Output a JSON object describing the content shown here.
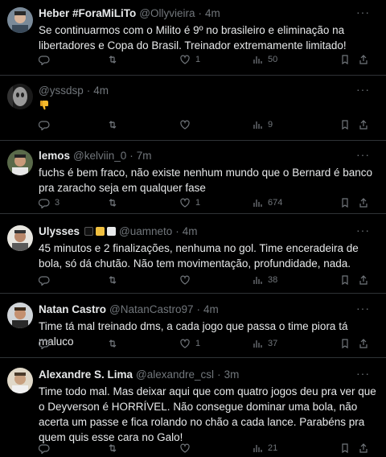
{
  "tweets": [
    {
      "name": "Heber #ForaMiLiTo",
      "handle": "@Ollyvieira",
      "time": "4m",
      "text": "Se continuarmos com o Milito é 9º no brasileiro e eliminação na libertadores e Copa do Brasil. Treinador extremamente limitado!",
      "replies": "",
      "retweets": "",
      "likes": "1",
      "views": "50"
    },
    {
      "name": "",
      "handle": "@yssdsp",
      "time": "4m",
      "text": "",
      "emoji": "thumbs-down",
      "replies": "",
      "retweets": "",
      "likes": "",
      "views": "9"
    },
    {
      "name": "lemos",
      "handle": "@kelviin_0",
      "time": "7m",
      "text": "fuchs é bem fraco, não existe nenhum mundo que o Bernard é banco pra zaracho seja em qualquer fase",
      "replies": "3",
      "retweets": "",
      "likes": "1",
      "views": "674"
    },
    {
      "name": "Ulysses",
      "handle": "@uamneto",
      "time": "4m",
      "text": "45 minutos e 2 finalizações, nenhuma no gol. Time enceradeira de bola, só dá chutão. Não tem movimentação, profundidade, nada.",
      "replies": "",
      "retweets": "",
      "likes": "",
      "views": "38"
    },
    {
      "name": "Natan Castro",
      "handle": "@NatanCastro97",
      "time": "4m",
      "text": "Time tá mal treinado dms, a cada jogo que passa o time piora tá maluco",
      "replies": "",
      "retweets": "",
      "likes": "1",
      "views": "37"
    },
    {
      "name": "Alexandre S. Lima",
      "handle": "@alexandre_csl",
      "time": "3m",
      "text": "Time todo mal. Mas deixar aqui que com quatro jogos deu pra ver que o Deyverson é HORRÍVEL. Não consegue dominar uma bola, não acerta um passe e fica rolando no chão a cada lance. Parabéns pra quem quis esse cara no Galo!",
      "replies": "",
      "retweets": "",
      "likes": "",
      "views": "21"
    }
  ],
  "dot": "·",
  "more": "···",
  "colors": {
    "background": "#000000",
    "text": "#e7e9ea",
    "muted": "#71767b",
    "divider": "#2f3336"
  }
}
